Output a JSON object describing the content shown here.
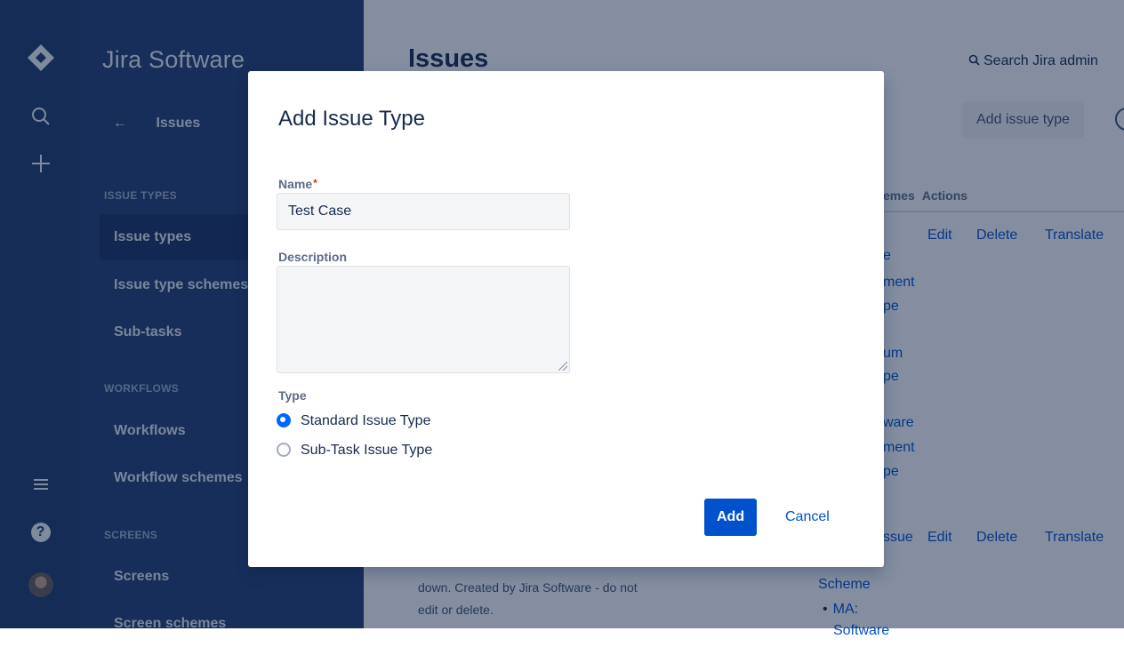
{
  "app": {
    "product_name": "Jira Software"
  },
  "rail": {
    "icons": [
      "jira-logo-icon",
      "search-icon",
      "plus-icon",
      "menu-icon",
      "help-icon",
      "avatar"
    ],
    "help_glyph": "?"
  },
  "sidebar": {
    "back_label": "Issues",
    "sections": [
      {
        "heading": "ISSUE TYPES",
        "items": [
          "Issue types",
          "Issue type schemes",
          "Sub-tasks"
        ]
      },
      {
        "heading": "WORKFLOWS",
        "items": [
          "Workflows",
          "Workflow schemes"
        ]
      },
      {
        "heading": "SCREENS",
        "items": [
          "Screens",
          "Screen schemes"
        ]
      }
    ],
    "active_item": "Issue types"
  },
  "page": {
    "title": "Issues",
    "search_label": "Search Jira admin",
    "add_issue_type_button": "Add issue type",
    "help_glyph": "?",
    "table": {
      "headers": {
        "schemes_fragment": "emes",
        "actions": "Actions"
      },
      "actions": [
        "Edit",
        "Delete",
        "Translate"
      ],
      "row1_scheme_fragments": [
        "e",
        "ment",
        "pe",
        "um",
        "pe",
        "ware",
        "ment",
        "pe"
      ],
      "row2_scheme_fragment": "ssue",
      "row2_scheme_rest": [
        "Scheme",
        "MA:",
        "Software"
      ],
      "row2_description": [
        "down. Created by Jira Software - do not",
        "edit or delete."
      ],
      "bullet": "•"
    }
  },
  "dialog": {
    "title": "Add Issue Type",
    "name_label": "Name",
    "required_marker": "*",
    "name_value": "Test Case",
    "description_label": "Description",
    "description_value": "",
    "type_label": "Type",
    "type_options": [
      {
        "label": "Standard Issue Type",
        "selected": true
      },
      {
        "label": "Sub-Task Issue Type",
        "selected": false
      }
    ],
    "add_button": "Add",
    "cancel_button": "Cancel"
  },
  "colors": {
    "rail": "#1f3a6b",
    "sidebar": "#223e70",
    "primary": "#0052cc",
    "required": "#de350b"
  }
}
